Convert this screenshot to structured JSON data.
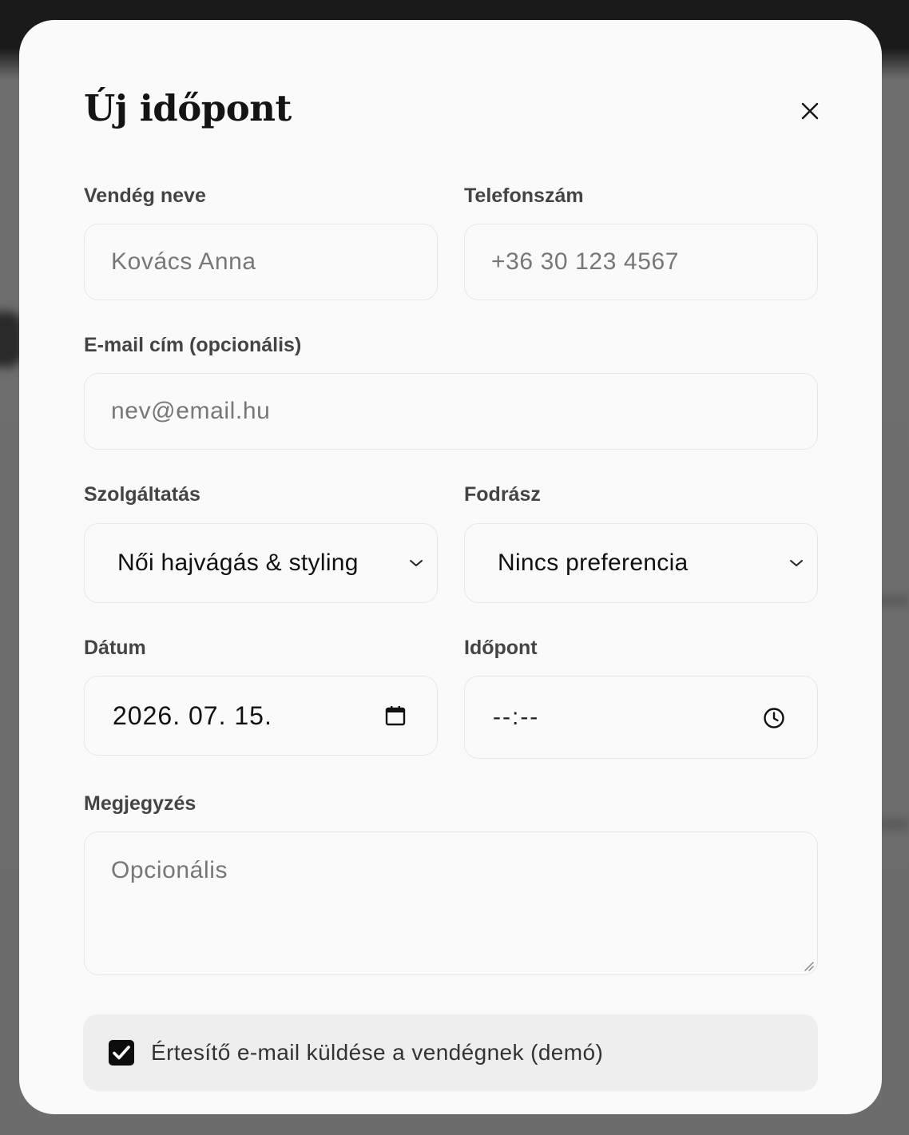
{
  "modal": {
    "title": "Új időpont",
    "close_icon": "close-icon"
  },
  "form": {
    "guest_name": {
      "label": "Vendég neve",
      "value": "",
      "placeholder": "Kovács Anna"
    },
    "phone": {
      "label": "Telefonszám",
      "value": "",
      "placeholder": "+36 30 123 4567"
    },
    "email": {
      "label": "E-mail cím (opcionális)",
      "value": "",
      "placeholder": "nev@email.hu"
    },
    "service": {
      "label": "Szolgáltatás",
      "selected": "Női hajvágás & styling",
      "icon": "chevron-down-icon"
    },
    "stylist": {
      "label": "Fodrász",
      "selected": "Nincs preferencia",
      "icon": "chevron-down-icon"
    },
    "date": {
      "label": "Dátum",
      "value": "2026. 07. 15.",
      "icon": "calendar-icon"
    },
    "time": {
      "label": "Időpont",
      "value": "--:--",
      "icon": "clock-icon"
    },
    "note": {
      "label": "Megjegyzés",
      "value": "",
      "placeholder": "Opcionális"
    },
    "notify": {
      "label": "Értesítő e-mail küldése a vendégnek (demó)",
      "checked": true
    }
  },
  "colors": {
    "modal_bg": "#fafafa",
    "text": "#141414",
    "label": "#444444",
    "border": "#e7e7e7",
    "notify_bg": "#eeeeee",
    "checkbox": "#0d0d0d"
  }
}
